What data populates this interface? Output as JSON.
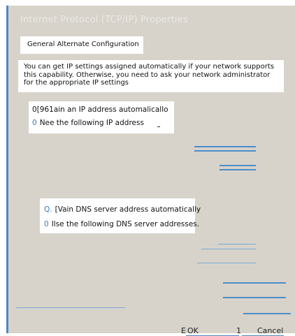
{
  "window": {
    "title": "Internet Protocol (TCP/IP) Properties"
  },
  "tabs": {
    "label": "General Alternate Configuration"
  },
  "description": "You can get IP settings assigned automatically if your network supports this capability. Otherwise, you need to ask your network administrator for the appropriate IP settings",
  "ip_section": {
    "auto_radio_symbol": "0",
    "auto_label": "[961ain an IP address automalicallo",
    "manual_radio_symbol": "0",
    "manual_label": "Nee the following IP address"
  },
  "dns_section": {
    "auto_radio_symbol": "Q.",
    "auto_label": "[Vain DNS server address automatically",
    "manual_radio_symbol": "0",
    "manual_label": "Ilse the following DNS server addresses."
  },
  "buttons": {
    "ok_prefix": "E",
    "ok_label": "OK",
    "cancel_prefix": "1",
    "cancel_label": "Cancel"
  },
  "colors": {
    "dialog_background": "#d7d3cb",
    "accent": "#4e86c6"
  }
}
